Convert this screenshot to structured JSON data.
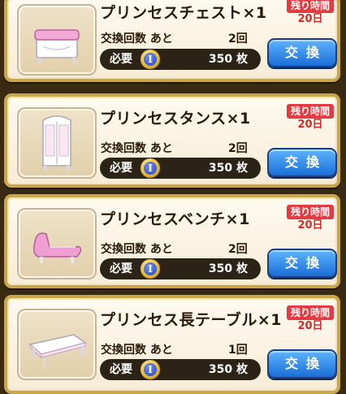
{
  "items": [
    {
      "name": "プリンセスチェスト×1",
      "remain_label": "残り時間",
      "remain_value": "20日",
      "count_label": "交換回数 あと",
      "count_value": "2回",
      "cost_label": "必要",
      "coin_symbol": "I",
      "cost_value": "350 枚",
      "button_label": "交換",
      "icon": "pink-chest-icon"
    },
    {
      "name": "プリンセスタンス×1",
      "remain_label": "残り時間",
      "remain_value": "20日",
      "count_label": "交換回数 あと",
      "count_value": "2回",
      "cost_label": "必要",
      "coin_symbol": "I",
      "cost_value": "350 枚",
      "button_label": "交換",
      "icon": "wardrobe-icon"
    },
    {
      "name": "プリンセスベンチ×1",
      "remain_label": "残り時間",
      "remain_value": "20日",
      "count_label": "交換回数 あと",
      "count_value": "2回",
      "cost_label": "必要",
      "coin_symbol": "I",
      "cost_value": "350 枚",
      "button_label": "交換",
      "icon": "pink-bench-icon"
    },
    {
      "name": "プリンセス長テーブル×1",
      "remain_label": "残り時間",
      "remain_value": "20日",
      "count_label": "交換回数 あと",
      "count_value": "1回",
      "cost_label": "必要",
      "coin_symbol": "I",
      "cost_value": "350 枚",
      "button_label": "交換",
      "icon": "long-table-icon"
    }
  ],
  "colors": {
    "frame": "#c9a64a",
    "remaining_badge": "#e43b43",
    "button": "#1a6ed6",
    "cost_bar": "#2b2416"
  }
}
